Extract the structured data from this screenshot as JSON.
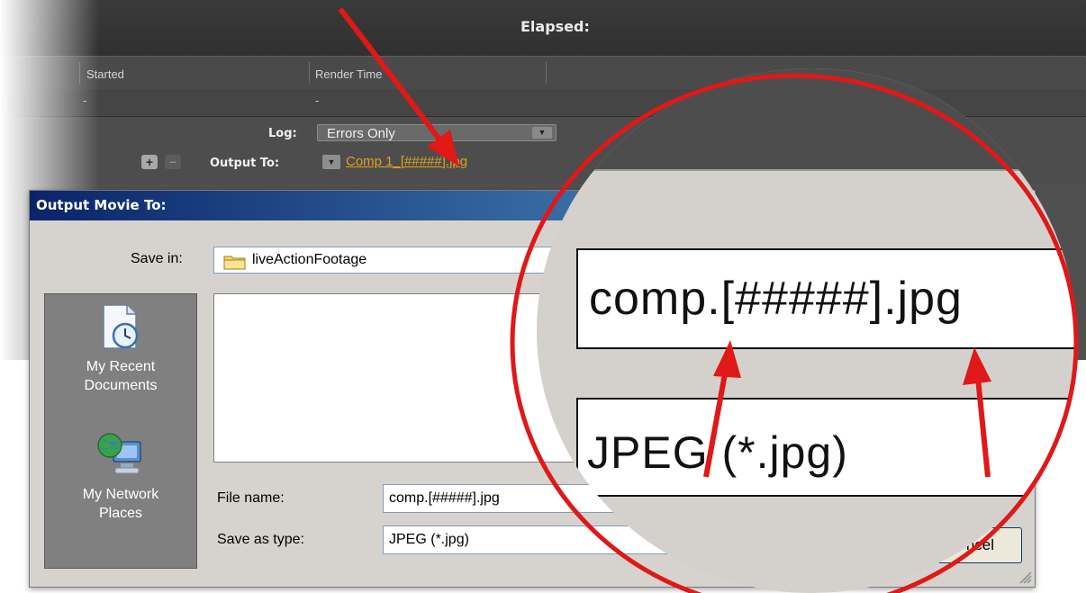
{
  "render_queue": {
    "elapsed_label": "Elapsed:",
    "columns": {
      "started": "Started",
      "render_time": "Render Time"
    },
    "row": {
      "started_value": "-",
      "render_time_value": "-"
    },
    "log": {
      "label": "Log:",
      "value": "Errors Only"
    },
    "output": {
      "label": "Output To:",
      "value": "Comp 1_[#####].jpg"
    },
    "add_glyph": "+",
    "remove_glyph": "−"
  },
  "dialog": {
    "title": "Output Movie To:",
    "save_in": {
      "label": "Save in:",
      "value": "liveActionFootage"
    },
    "places": [
      {
        "line1": "My Recent",
        "line2": "Documents",
        "icon": "recent-documents-icon"
      },
      {
        "line1": "My Network",
        "line2": "Places",
        "icon": "network-places-icon"
      }
    ],
    "file_name": {
      "label": "File name:",
      "value": "comp.[#####].jpg"
    },
    "save_as_type": {
      "label": "Save as type:",
      "value": "JPEG (*.jpg)"
    },
    "cancel_label": "ncel"
  },
  "magnifier": {
    "file_name": "comp.[#####].jpg",
    "file_type": "JPEG (*.jpg)"
  },
  "colors": {
    "annotation_red": "#e01818",
    "output_link": "#e0a020",
    "title_bar": "#0a246a"
  }
}
